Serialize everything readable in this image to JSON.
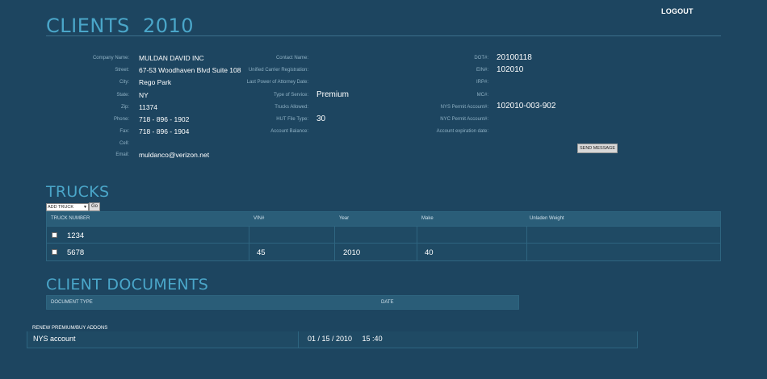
{
  "header": {
    "logout": "LOGOUT",
    "title": "CLIENTS  2010"
  },
  "client": {
    "col1": [
      {
        "label": "Company Name:",
        "value": "MULDAN DAVID INC"
      },
      {
        "label": "Street:",
        "value": "67-53 Woodhaven Blvd Suite 108"
      },
      {
        "label": "City:",
        "value": "Rego Park"
      },
      {
        "label": "State:",
        "value": "NY"
      },
      {
        "label": "Zip:",
        "value": "11374"
      },
      {
        "label": "Phone:",
        "value": "718 - 896 - 1902"
      },
      {
        "label": "Fax:",
        "value": "718 - 896 - 1904"
      },
      {
        "label": "Cell:",
        "value": ""
      },
      {
        "label": "Email:",
        "value": "muldanco@verizon.net"
      }
    ],
    "col2": [
      {
        "label": "Contact Name:",
        "value": ""
      },
      {
        "label": "Unified Carrier Registration:",
        "value": ""
      },
      {
        "label": "Last Power of Attorney Date:",
        "value": ""
      },
      {
        "label": "Type of Service:",
        "value": "Premium"
      },
      {
        "label": "Trucks Allowed:",
        "value": ""
      },
      {
        "label": "HUT File Type:",
        "value": "30"
      },
      {
        "label": "Account Balance:",
        "value": ""
      }
    ],
    "col3": [
      {
        "label": "DOT#:",
        "value": "20100118"
      },
      {
        "label": "EIN#:",
        "value": "102010"
      },
      {
        "label": "IRP#:",
        "value": ""
      },
      {
        "label": "MC#:",
        "value": ""
      },
      {
        "label": "NYS Permit Account#:",
        "value": "102010-003-902"
      },
      {
        "label": "NYC Permit Account#:",
        "value": ""
      },
      {
        "label": "Account expiration date:",
        "value": ""
      }
    ],
    "send_message": "SEND MESSAGE"
  },
  "trucks": {
    "title": "TRUCKS",
    "select_value": "ADD TRUCK",
    "go": "Go",
    "headers": [
      "TRUCK NUMBER",
      "VIN#",
      "Year",
      "Make",
      "Unladen Weight"
    ],
    "rows": [
      {
        "number": "1234",
        "vin": "",
        "year": "",
        "make": "",
        "weight": ""
      },
      {
        "number": "5678",
        "vin": "45",
        "year": "2010",
        "make": "40",
        "weight": ""
      }
    ]
  },
  "documents": {
    "title": "CLIENT DOCUMENTS",
    "headers": [
      "DOCUMENT TYPE",
      "DATE"
    ]
  },
  "addons": {
    "renew": "RENEW PREMIUM/BUY ADDONS",
    "item": "NYS account",
    "date": "01 / 15 / 2010     15 :40"
  }
}
